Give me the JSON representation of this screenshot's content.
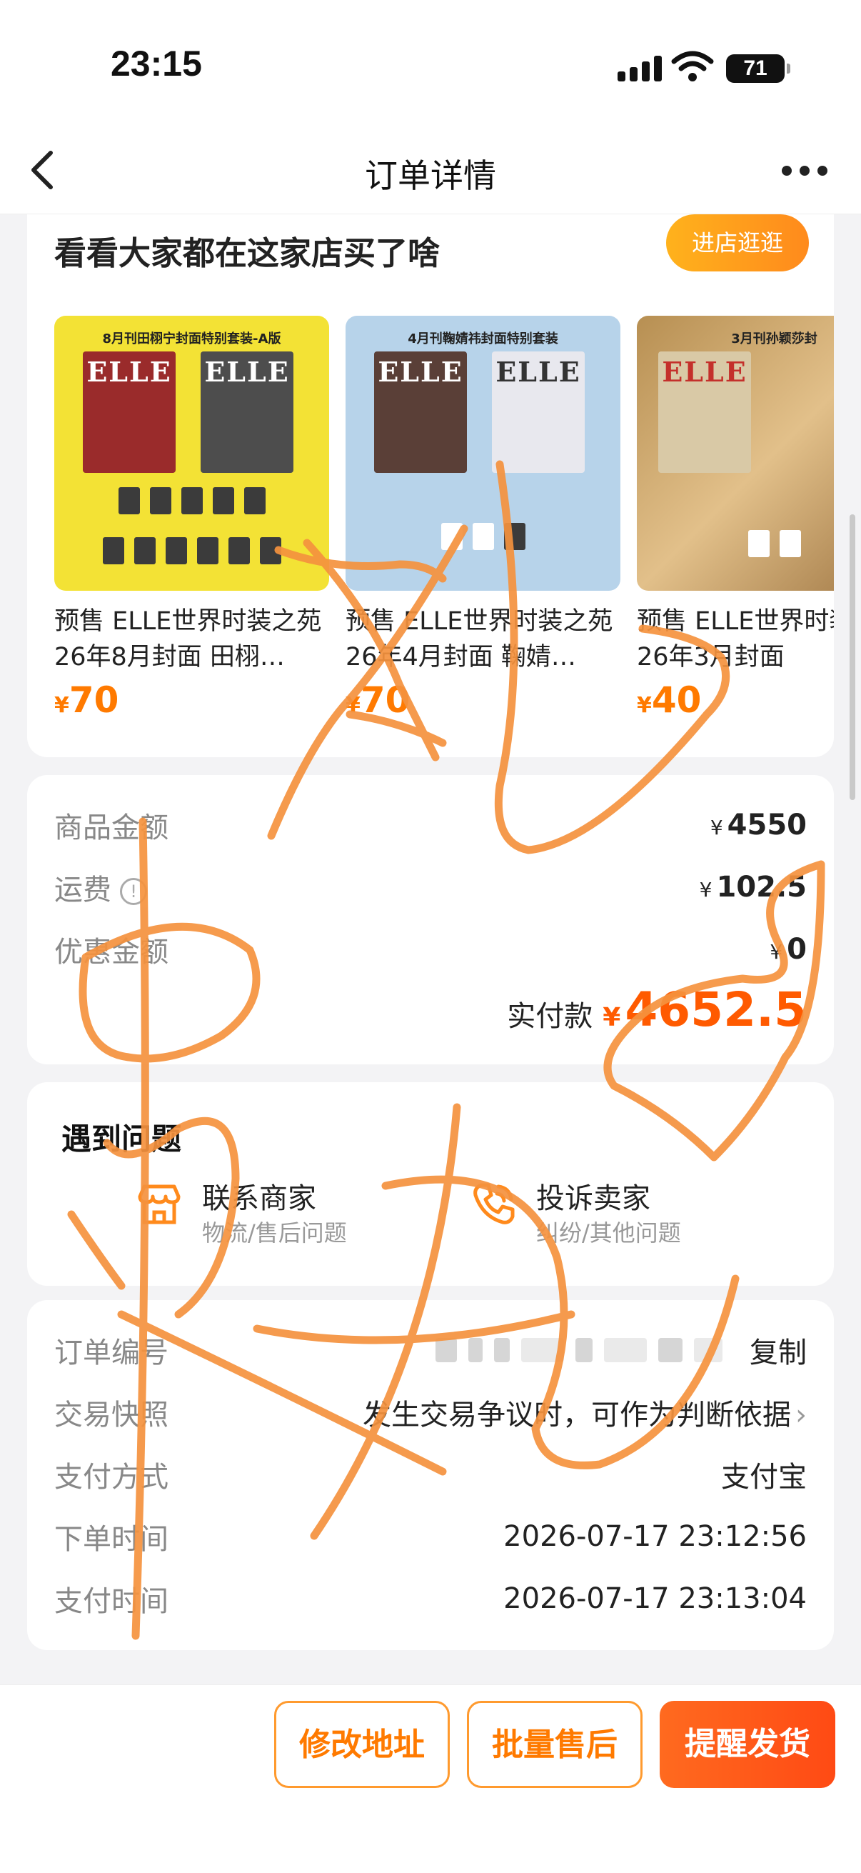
{
  "status": {
    "time": "23:15",
    "battery": "71"
  },
  "nav": {
    "title": "订单详情"
  },
  "recommend": {
    "title": "看看大家都在这家店买了啥",
    "store_button": "进店逛逛",
    "items": [
      {
        "caption": "8月刊田栩宁封面特别套装-A版",
        "name": "预售 ELLE世界时装之苑 26年8月封面 田栩…",
        "currency": "¥",
        "price": "70",
        "theme": "#f3e235"
      },
      {
        "caption": "4月刊鞠婧祎封面特别套装",
        "name": "预售 ELLE世界时装之苑 26年4月封面 鞠婧…",
        "currency": "¥",
        "price": "70",
        "theme": "#b7d3ea"
      },
      {
        "caption": "3月刊孙颖莎封",
        "name": "预售 ELLE世界时装之苑 26年3月封面",
        "currency": "¥",
        "price": "40",
        "theme": "#d2ad72"
      }
    ]
  },
  "summary": {
    "goods_label": "商品金额",
    "goods_currency": "¥",
    "goods_value": "4550",
    "shipping_label": "运费",
    "shipping_currency": "¥",
    "shipping_value": "102.5",
    "discount_label": "优惠金额",
    "discount_currency": "¥",
    "discount_value": "0",
    "paid_label": "实付款",
    "paid_currency": "¥",
    "paid_value": "4652.5"
  },
  "help": {
    "title": "遇到问题",
    "items": [
      {
        "name": "联系商家",
        "sub": "物流/售后问题",
        "icon": "store-icon"
      },
      {
        "name": "投诉卖家",
        "sub": "纠纷/其他问题",
        "icon": "phone-icon"
      }
    ]
  },
  "order": {
    "id_label": "订单编号",
    "copy": "复制",
    "snapshot_label": "交易快照",
    "snapshot_value": "发生交易争议时，可作为判断依据",
    "pay_method_label": "支付方式",
    "pay_method_value": "支付宝",
    "order_time_label": "下单时间",
    "order_time_value": "2026-07-17 23:12:56",
    "pay_time_label": "支付时间",
    "pay_time_value": "2026-07-17 23:13:04"
  },
  "actions": {
    "modify_address": "修改地址",
    "batch_after_sale": "批量售后",
    "remind_ship": "提醒发货"
  },
  "colors": {
    "accent": "#ff7a00",
    "primary_button": "#ff5a1a",
    "scribble": "#f5923e"
  }
}
